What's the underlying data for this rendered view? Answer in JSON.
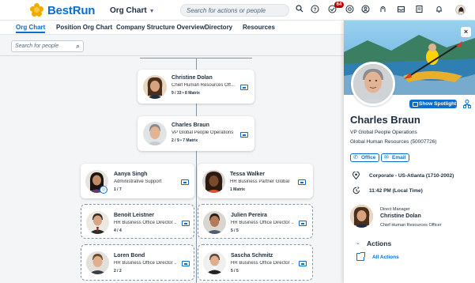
{
  "header": {
    "brand": "BestRun",
    "module": "Org Chart",
    "search_placeholder": "Search for actions or people",
    "notifications_count": "64"
  },
  "tabs": [
    {
      "label": "Org Chart",
      "active": true
    },
    {
      "label": "Position Org Chart",
      "active": false
    },
    {
      "label": "Company Structure Overview",
      "active": false
    },
    {
      "label": "Directory",
      "active": false
    },
    {
      "label": "Resources",
      "active": false
    }
  ],
  "people_search": {
    "placeholder": "Search for people"
  },
  "chart_nodes": {
    "christine": {
      "name": "Christine Dolan",
      "title": "Chief Human Resources Off...",
      "meta": "9 / 33 • 8 Matrix"
    },
    "charles": {
      "name": "Charles Braun",
      "title": "VP Global People Operations",
      "meta": "2 / 9 • 7 Matrix"
    },
    "aanya": {
      "name": "Aanya Singh",
      "title": "Administrative Support",
      "meta": "1 / 7"
    },
    "tessa": {
      "name": "Tessa Walker",
      "title": "HR Business Partner Global",
      "meta": "1 Matrix"
    },
    "benoit": {
      "name": "Benoit Leistner",
      "title": "HR Business Office Director ...",
      "meta": "4 / 4"
    },
    "julien": {
      "name": "Julien Pereira",
      "title": "HR Business Office Director ...",
      "meta": "5 / 5"
    },
    "loren": {
      "name": "Loren Bond",
      "title": "HR Business Office Director ...",
      "meta": "2 / 2"
    },
    "sascha": {
      "name": "Sascha Schmitz",
      "title": "HR Business Office Director ...",
      "meta": "5 / 5"
    }
  },
  "profile": {
    "spotlight_label": "Show Spotlight",
    "name": "Charles Braun",
    "title": "VP Global People Operations",
    "department": "Global Human Resources (50007726)",
    "office_label": "Office",
    "email_label": "Email",
    "location": "Corporate - US-Atlanta (1710-2002)",
    "local_time": "11:42 PM (Local Time)",
    "manager_label": "Direct Manager",
    "manager_name": "Christine Dolan",
    "manager_title": "Chief Human Resources Officer",
    "actions_heading": "Actions",
    "all_actions_label": "All Actions"
  },
  "colors": {
    "accent": "#0a6ed1",
    "brand_flower": "#f0ab00",
    "badge": "#bb0000"
  }
}
